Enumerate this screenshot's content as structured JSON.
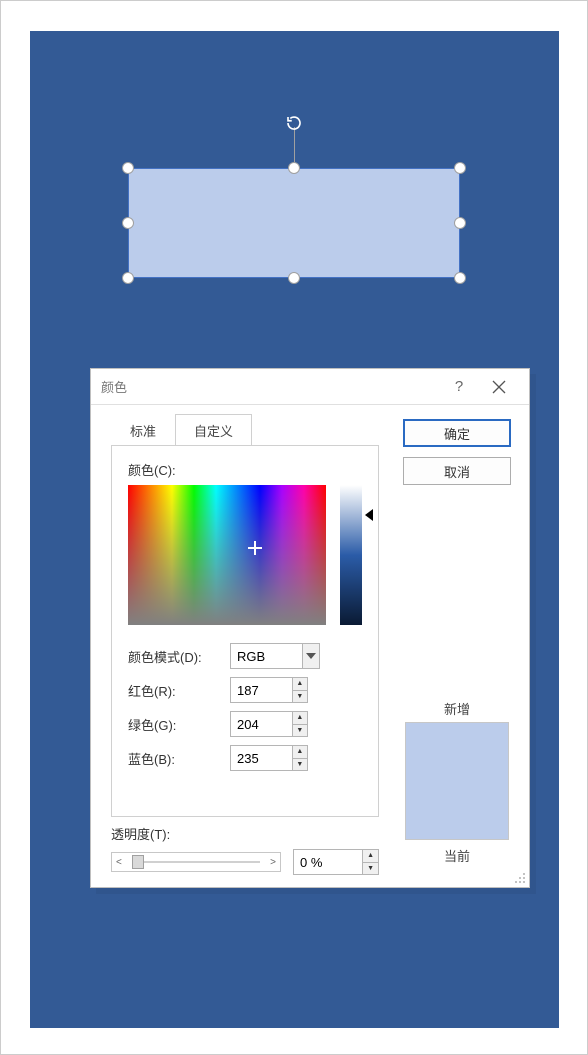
{
  "dialog": {
    "title": "颜色",
    "help_char": "?",
    "tabs": {
      "standard": "标准",
      "custom": "自定义"
    },
    "color_label": "颜色(C):",
    "mode_label": "颜色模式(D):",
    "mode_value": "RGB",
    "red_label": "红色(R):",
    "green_label": "绿色(G):",
    "blue_label": "蓝色(B):",
    "red_value": "187",
    "green_value": "204",
    "blue_value": "235",
    "transparency_label": "透明度(T):",
    "transparency_value": "0 %",
    "ok": "确定",
    "cancel": "取消",
    "preview_new": "新增",
    "preview_current": "当前"
  },
  "shape": {
    "fill": "#bbcceb"
  }
}
